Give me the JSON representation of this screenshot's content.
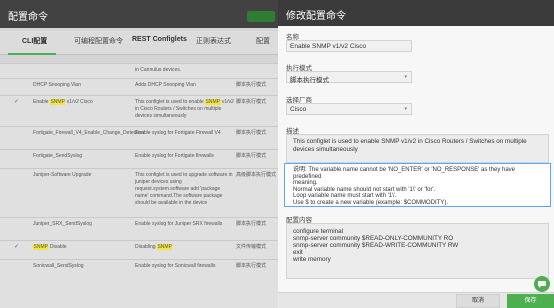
{
  "background": {
    "title": "配置命令",
    "tabs": [
      "CLI配置",
      "可编程配置命令",
      "REST Configlets",
      "正则表达式",
      "配置"
    ],
    "rows": [
      {
        "name": "",
        "description": "in Cannulus devices.",
        "mode": "",
        "checked": false
      },
      {
        "name": "DHCP Snooping Vlan",
        "description": "Adds DHCP Snooping Vlan",
        "mode": "脚本执行模式",
        "checked": false
      },
      {
        "name_parts": [
          "Enable ",
          "SNMP",
          " v1/v2 Cisco"
        ],
        "description_parts": [
          "This configlet is used to enable ",
          "SNMP",
          " v1/v2 in Cisco Routers / Switches on multiple devices simultaneously"
        ],
        "mode": "脚本执行模式",
        "checked": true
      },
      {
        "name": "Fortigate_Firewall_V4_Enable_Change_Detection",
        "description": "Enable syslog for Fortigate Firewall V4",
        "mode": "脚本执行模式",
        "checked": false
      },
      {
        "name": "Fortigate_SendSyslog",
        "description": "Enable syslog for Fortigate firewalls",
        "mode": "脚本执行模式",
        "checked": false
      },
      {
        "name": "Juniper-Software Upgrade",
        "description": "This configlet is used to upgrade software in juniper devices using request.system.software add 'package name' command.The software package should be available in the device",
        "mode": "高级脚本执行模式",
        "checked": false
      },
      {
        "name": "Juniper_SRX_SendSyslog",
        "description": "Enable syslog for Juniper SRX firewalls",
        "mode": "脚本执行模式",
        "checked": false
      },
      {
        "name_parts": [
          "SNMP",
          " Disable"
        ],
        "description_parts": [
          "Disabling ",
          "SNMP",
          ""
        ],
        "mode": "文件传输模式",
        "checked": true
      },
      {
        "name": "Sonicwall_SendSyslog",
        "description": "Enable syslog for Sonicwall firewalls",
        "mode": "脚本执行模式",
        "checked": false
      }
    ]
  },
  "drawer": {
    "title": "修改配置命令",
    "name_label": "名称",
    "name_value": "Enable SNMP v1/v2 Cisco",
    "mode_label": "执行模式",
    "mode_value": "脚本执行模式",
    "vendor_label": "选择厂商",
    "vendor_value": "Cisco",
    "description_label": "描述",
    "description_value": "This configlet is used to enable SNMP v1/v2 in Cisco Routers / Switches on multiple devices simultaneously",
    "note_lines": [
      "说明:   The variable name cannot be 'NO_ENTER' or 'NO_RESPONSE' as they have predefined",
      "meaning.",
      "Normal variable name should not start with '1\\' or 'for'.",
      "Loop variable name must start with '1\\'.",
      "Use $ to create a new variable (example: $COMMODITY)."
    ],
    "config_label": "配置内容",
    "config_lines": [
      "configure terminal",
      "snmp-server community $READ-ONLY-COMMUNITY RO",
      "snmp-server community $READ-WRITE-COMMUNITY RW",
      "exit",
      "write memory"
    ],
    "cancel_label": "取消",
    "save_label": "保存"
  },
  "icons": {
    "chat": "chat-bubble-icon",
    "check": "check-icon",
    "caret": "caret-down-icon"
  },
  "colors": {
    "accent": "#4caf50",
    "header": "#3b3b3b",
    "highlight": "#f5e53b",
    "focus_border": "#5aa7ff"
  }
}
